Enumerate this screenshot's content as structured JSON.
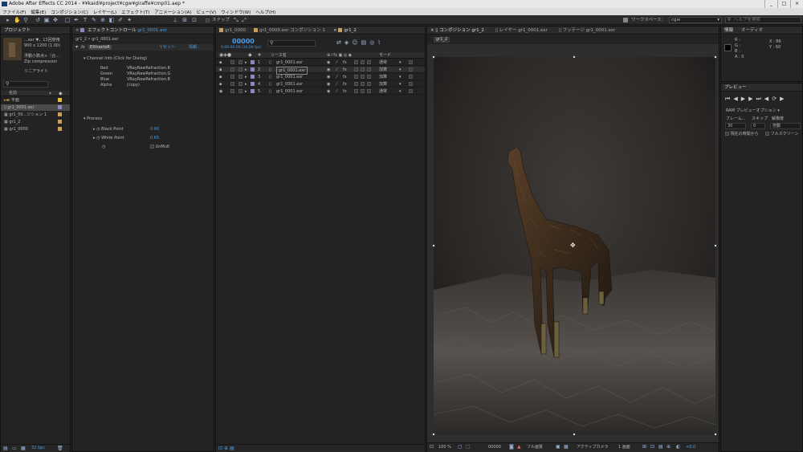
{
  "window": {
    "title": "Adobe After Effects CC 2014 - ¥¥kaidi¥project¥cgw¥giraffe¥cmp01.aep *",
    "buttons": [
      "_",
      "□",
      "×"
    ]
  },
  "menu": [
    "ファイル(F)",
    "編集(E)",
    "コンポジション(C)",
    "レイヤー(L)",
    "エフェクト(T)",
    "アニメーション(A)",
    "ビュー(V)",
    "ウィンドウ(W)",
    "ヘルプ(H)"
  ],
  "toolbar": {
    "snap_label": "スナップ",
    "workspace_label": "ワークスペース：",
    "workspace_value": "cgw",
    "help_search_placeholder": "ヘルプを検索"
  },
  "project": {
    "tab": "プロジェクト",
    "selected_name": "...exr ▼，13回使用",
    "selected_size": "900 x 1200 (1.00)",
    "selected_type": "浮動小数点+（合...",
    "selected_compression": "Zip compression",
    "selected_premult": "リニアライト",
    "column_name": "名前",
    "items": [
      {
        "name": "平面",
        "type": "folder",
        "color": "#e0c040"
      },
      {
        "name": "gr1_0001.exr",
        "type": "footage",
        "color": "#8a8ab8"
      },
      {
        "name": "gr1_00...ジション 1",
        "type": "comp",
        "color": "#c8a060"
      },
      {
        "name": "gr1_2",
        "type": "comp",
        "color": "#c8a060"
      },
      {
        "name": "gr1_0000",
        "type": "comp",
        "color": "#c8a060"
      }
    ],
    "bpc": "32 bpc"
  },
  "effects": {
    "tab": "エフェクトコントロール",
    "tab_target": "gr1_0001.exr",
    "breadcrumb": "gr1_2 • gr1_0001.exr",
    "effect_name": "EXtractoR",
    "reset_label": "リセット",
    "info_label": "情報...",
    "channel_info": "Channel Info (Click for Dialog)",
    "channels": [
      {
        "label": "Red",
        "value": "VRayRawRefraction.R"
      },
      {
        "label": "Green",
        "value": "VRayRawRefraction.G"
      },
      {
        "label": "Blue",
        "value": "VRayRawRefraction.B"
      },
      {
        "label": "Alpha",
        "value": "(copy)"
      }
    ],
    "process_label": "Process",
    "black_point_label": "Black Point",
    "black_point_value": "0.00",
    "white_point_label": "White Point",
    "white_point_value": "0.65",
    "unmult_label": "UnMult"
  },
  "timeline": {
    "timecode": "00000",
    "timecode_sub": "0:00:00:00 (30.00 fps)",
    "col_source": "ソース名",
    "col_mode": "モード",
    "layers": [
      {
        "num": "1",
        "name": "gr1_0001.exr",
        "mode": "通常"
      },
      {
        "num": "2",
        "name": "gr1_0001.exr",
        "mode": "加算"
      },
      {
        "num": "3",
        "name": "gr1_0001.exr",
        "mode": "加算"
      },
      {
        "num": "4",
        "name": "gr1_0001.exr",
        "mode": "加算"
      },
      {
        "num": "5",
        "name": "gr1_0001.exr",
        "mode": "通常"
      }
    ],
    "tabs": [
      "gr1_0000",
      "gr1_0000.exr コンポジション 1",
      "gr1_2"
    ]
  },
  "viewer": {
    "tabs": [
      "コンポジション gr1_2",
      "レイヤー gr1_0001.exr",
      "フッテージ gr1_0001.exr"
    ],
    "comp_label": "gr1_2",
    "zoom": "100 %",
    "frame": "00000",
    "resolution": "フル画質",
    "camera": "アクティブカメラ",
    "views": "1 画面",
    "exposure": "+0.0"
  },
  "info": {
    "tab": "情報",
    "tab2": "オーディオ",
    "r": "R :",
    "g": "G :",
    "b": "B :",
    "a": "A : 0",
    "x": "X : 86",
    "y": "Y : 60"
  },
  "preview": {
    "tab": "プレビュー",
    "ram_label": "RAM プレビューオプション",
    "frame_rate_label": "フレーム...",
    "skip_label": "スキップ",
    "res_label": "解像度",
    "frame_rate_value": "30",
    "skip_value": "0",
    "res_value": "自動",
    "from_current": "現在の時間から",
    "fullscreen": "フルスクリーン"
  },
  "colors": {
    "accent": "#4a9ee8",
    "panel_bg": "#232323"
  }
}
